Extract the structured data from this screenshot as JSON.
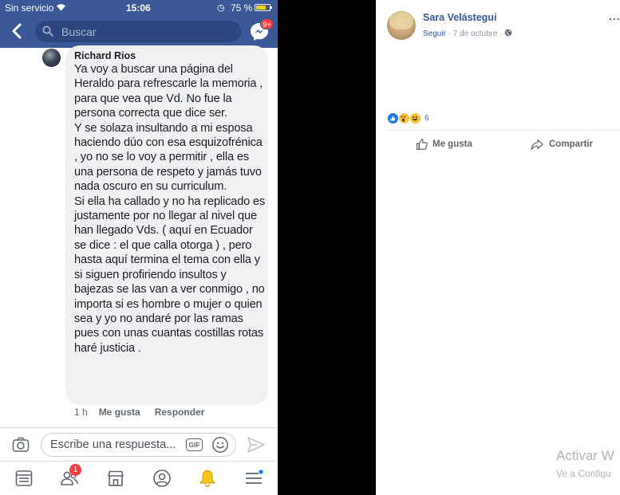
{
  "status_bar": {
    "carrier": "Sin servicio",
    "time": "15:06",
    "battery": "75 %",
    "battery_level": 0.75
  },
  "nav_bar": {
    "search_placeholder": "Buscar",
    "messenger_badge": "9+"
  },
  "comment": {
    "author": "Richard Rios",
    "text": "Ya voy a buscar una página del Heraldo para refrescarle la memoria , para que vea que Vd. No fue la persona correcta que dice ser.\nY se solaza insultando a mi esposa haciendo dúo con esa esquizofrénica , yo no se lo voy a permitir , ella es una persona de respeto y jamás tuvo nada oscuro en su curriculum.\nSi ella ha callado y no ha replicado es justamente por no llegar al nivel que han llegado Vds. ( aquí en Ecuador se dice : el que calla otorga ) , pero hasta aquí  termina el tema con ella y si siguen profiriendo insultos y bajezas se las van a ver conmigo , no importa si es hombre o mujer o quien sea y yo no andaré por las ramas pues con unas cuantas costillas rotas haré justicia .",
    "time": "1 h",
    "like_label": "Me gusta",
    "reply_label": "Responder"
  },
  "reply_bar": {
    "placeholder": "Escribe una respuesta...",
    "gif_label": "GIF"
  },
  "tab_bar": {
    "items": [
      "news-feed-icon",
      "friends-icon",
      "marketplace-icon",
      "profile-icon",
      "notifications-icon",
      "menu-icon"
    ],
    "friends_badge": "1"
  },
  "post": {
    "author": "Sara Velástegui",
    "follow_label": "Seguir",
    "date": "7 de octubre",
    "more": "...",
    "reaction_count": "6",
    "like_label": "Me gusta",
    "share_label": "Compartir"
  },
  "watermark": {
    "title": "Activar W",
    "subtitle": "Ve a Configu"
  },
  "colors": {
    "brand": "#3b5998",
    "link": "#365899",
    "badge": "#fa3e3e"
  }
}
